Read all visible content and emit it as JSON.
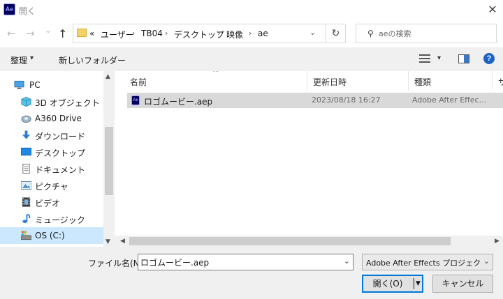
{
  "window": {
    "title": "開く",
    "app_icon": "Ae",
    "close_glyph": "✕"
  },
  "nav": {
    "back_glyph": "←",
    "forward_glyph": "→",
    "recent_glyph": "⌄",
    "up_glyph": "↑",
    "breadcrumb_overflow": "«",
    "breadcrumbs": [
      "ユーザー",
      "TB04",
      "デスクトップ",
      "映像",
      "ae"
    ],
    "separator": "›",
    "address_dropdown_glyph": "⌄",
    "refresh_glyph": "↻",
    "search_icon_glyph": "⚲",
    "search_placeholder": "aeの検索"
  },
  "toolbar": {
    "organize_label": "整理",
    "organize_caret": "▾",
    "new_folder_label": "新しいフォルダー",
    "view_caret": "▾",
    "help_glyph": "?"
  },
  "sidebar": {
    "items": [
      {
        "label": "PC",
        "icon": "pc-icon"
      },
      {
        "label": "3D オブジェクト",
        "icon": "3d-objects-icon"
      },
      {
        "label": "A360 Drive",
        "icon": "a360-drive-icon"
      },
      {
        "label": "ダウンロード",
        "icon": "download-icon"
      },
      {
        "label": "デスクトップ",
        "icon": "desktop-icon"
      },
      {
        "label": "ドキュメント",
        "icon": "documents-icon"
      },
      {
        "label": "ピクチャ",
        "icon": "pictures-icon"
      },
      {
        "label": "ビデオ",
        "icon": "videos-icon"
      },
      {
        "label": "ミュージック",
        "icon": "music-icon"
      },
      {
        "label": "OS (C:)",
        "icon": "drive-icon",
        "selected": true
      }
    ],
    "scroll_up_glyph": "▲",
    "scroll_down_glyph": "▼"
  },
  "files": {
    "columns": [
      "名前",
      "更新日時",
      "種類",
      "サ"
    ],
    "sort_glyph": "^",
    "rows": [
      {
        "icon_text": "Ae",
        "name": "ロゴムービー.aep",
        "modified": "2023/08/18 16:27",
        "type": "Adobe After Effect..."
      }
    ],
    "scroll_left_glyph": "◀",
    "scroll_right_glyph": "▶"
  },
  "bottom": {
    "filename_label": "ファイル名(N):",
    "filename_value": "ロゴムービー.aep",
    "filename_dropdown_glyph": "⌄",
    "filetype_value": "Adobe After Effects プロジェクト (",
    "filetype_dropdown_glyph": "⌄",
    "open_label": "開く(O)",
    "open_caret": "▼",
    "cancel_label": "キャンセル"
  },
  "colors": {
    "accent": "#0078d7",
    "selection": "#cce8ff",
    "ae_brand": "#00005b",
    "ae_brand_light": "#9999ff"
  }
}
